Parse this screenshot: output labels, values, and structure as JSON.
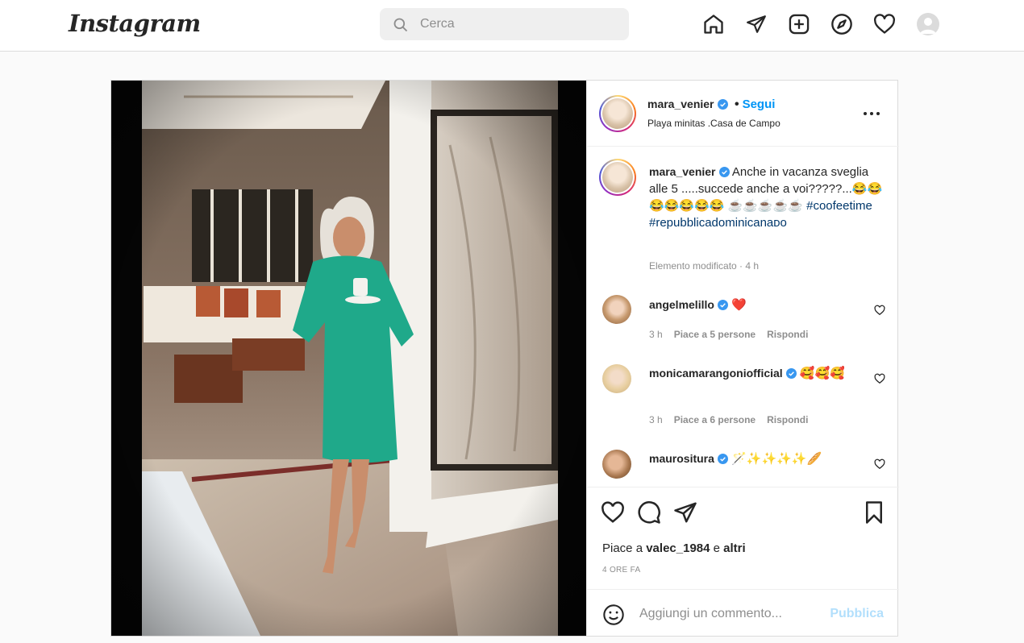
{
  "header": {
    "logo": "Instagram",
    "search_placeholder": "Cerca",
    "icons": [
      "home-icon",
      "direct-message-icon",
      "new-post-icon",
      "explore-icon",
      "activity-heart-icon",
      "profile-avatar"
    ]
  },
  "post": {
    "author": {
      "username": "mara_venier",
      "verified": true,
      "follow_label": "Segui",
      "separator": "•",
      "location": "Playa minitas .Casa de Campo"
    },
    "caption": {
      "username": "mara_venier",
      "text": "Anche in vacanza sveglia alle 5 .....succede anche a voi?????...😂😂😂😂😂😂😂 ☕☕☕☕☕",
      "hashtags": [
        "#coofeetime",
        "#repubblicadominicanaᴅᴏ"
      ],
      "edited": "Elemento modificato · 4 h"
    },
    "comments": [
      {
        "username": "angelmelillo",
        "verified": true,
        "text": "❤️",
        "time": "3 h",
        "likes": "Piace a 5 persone",
        "reply": "Rispondi"
      },
      {
        "username": "monicamarangoniofficial",
        "verified": true,
        "text": "🥰🥰🥰",
        "time": "3 h",
        "likes": "Piace a 6 persone",
        "reply": "Rispondi"
      },
      {
        "username": "maurositura",
        "verified": true,
        "text": "🪄✨✨✨✨🥖",
        "time": "",
        "likes": "",
        "reply": ""
      }
    ],
    "likes": {
      "prefix": "Piace a",
      "user": "valec_1984",
      "joiner": "e",
      "others": "altri"
    },
    "time_ago": "4 ORE FA",
    "add_comment": {
      "placeholder": "Aggiungi un commento...",
      "publish": "Pubblica"
    }
  },
  "colors": {
    "accent": "#0095f6",
    "publish_disabled": "#b2dffc",
    "verified": "#3897f0",
    "heart_red": "#ed4956"
  }
}
